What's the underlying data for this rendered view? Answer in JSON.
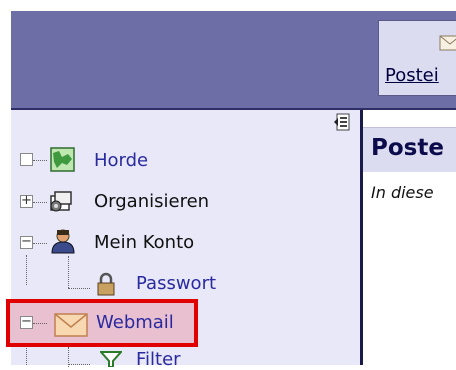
{
  "header": {
    "inbox_tab_label": "Postei"
  },
  "sidebar": {
    "items": [
      {
        "label": "Horde",
        "expander": "",
        "is_link": true
      },
      {
        "label": "Organisieren",
        "expander": "+",
        "is_link": false
      },
      {
        "label": "Mein Konto",
        "expander": "−",
        "is_link": false
      },
      {
        "label": "Passwort",
        "is_link": true
      },
      {
        "label": "Webmail",
        "expander": "−",
        "is_link": true,
        "highlighted": true
      },
      {
        "label": "Filter",
        "is_link": true
      }
    ]
  },
  "content": {
    "title": "Poste",
    "description": "In diese"
  },
  "colors": {
    "header_bg": "#6e6ea6",
    "sidebar_bg": "#e8e8f8",
    "link": "#2a2aa0",
    "highlight_border": "#e00000"
  }
}
